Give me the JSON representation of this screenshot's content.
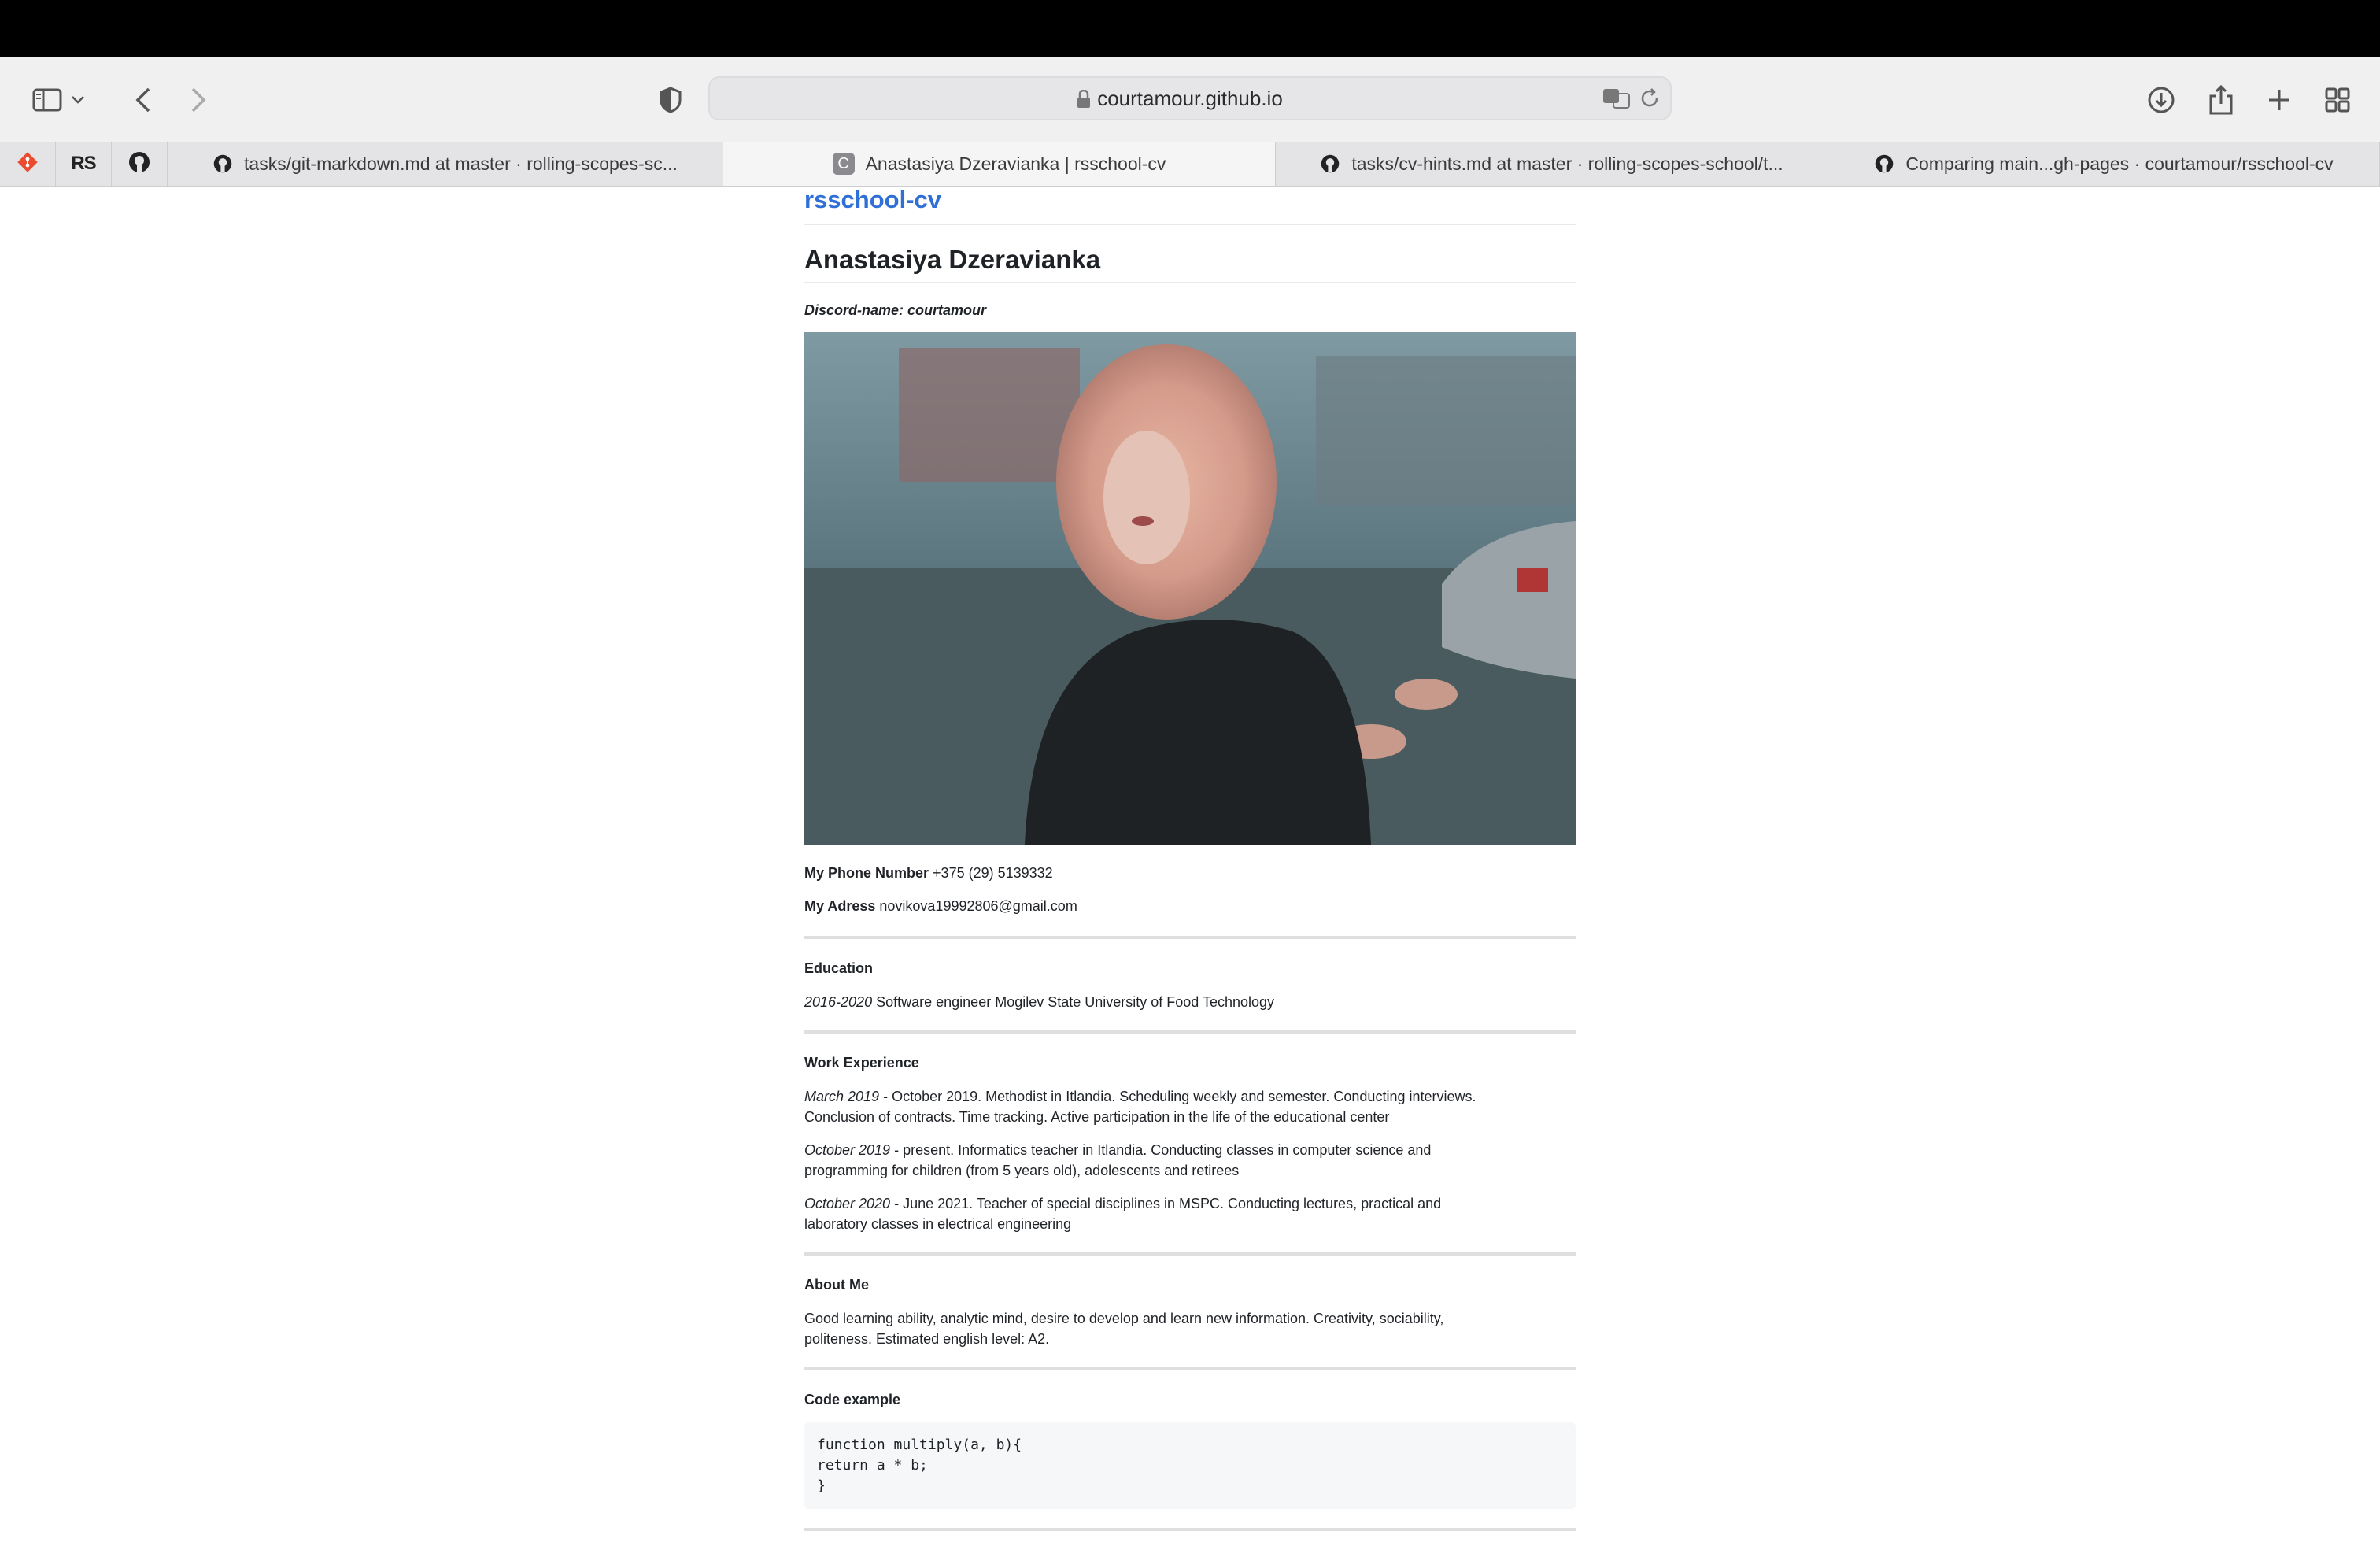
{
  "browser": {
    "url": "courtamour.github.io",
    "tabs": [
      {
        "label": "tasks/git-markdown.md at master · rolling-scopes-sc...",
        "icon": "github-icon"
      },
      {
        "label": "Anastasiya Dzeravianka | rsschool-cv",
        "icon": "letter-c-icon"
      },
      {
        "label": "tasks/cv-hints.md at master · rolling-scopes-school/t...",
        "icon": "github-icon"
      },
      {
        "label": "Comparing main...gh-pages · courtamour/rsschool-cv",
        "icon": "github-icon"
      }
    ],
    "pinned": [
      "git-icon",
      "rs-logo-icon",
      "github-icon"
    ],
    "pinned_rs_text": "RS",
    "favicon_letter": "C"
  },
  "page": {
    "site_title": "rsschool-cv",
    "name": "Anastasiya Dzeravianka",
    "discord": "Discord-name: courtamour",
    "photo_alt": "Portrait photo",
    "phone_label": "My Phone Number",
    "phone_value": "+375 (29) 5139332",
    "address_label": "My Adress",
    "address_value": "novikova19992806@gmail.com",
    "education": {
      "heading": "Education",
      "years": "2016-2020",
      "text": "Software engineer Mogilev State University of Food Technology"
    },
    "work": {
      "heading": "Work Experience",
      "items": [
        {
          "date": "March 2019",
          "line1": "- October 2019. Methodist in Itlandia. Scheduling weekly and semester. Conducting interviews.",
          "line2": "Conclusion of contracts. Time tracking. Active participation in the life of the educational center"
        },
        {
          "date": "October 2019",
          "line1": "- present. Informatics teacher in Itlandia. Conducting classes in computer science and",
          "line2": "programming for children (from 5 years old), adolescents and retirees"
        },
        {
          "date": "October 2020",
          "line1": "- June 2021. Teacher of special disciplines in MSPC. Conducting lectures, practical and",
          "line2": "laboratory classes in electrical engineering"
        }
      ]
    },
    "about": {
      "heading": "About Me",
      "line1": "Good learning ability, analytic mind, desire to develop and learn new information. Creativity, sociability,",
      "line2": "politeness. Estimated english level: A2."
    },
    "code": {
      "heading": "Code example",
      "lines": [
        "function multiply(a, b){",
        "return a * b;",
        "}"
      ]
    }
  },
  "colors": {
    "link": "#2f6fd6",
    "topbar": "#000000",
    "toolbar": "#f1f0f1"
  }
}
